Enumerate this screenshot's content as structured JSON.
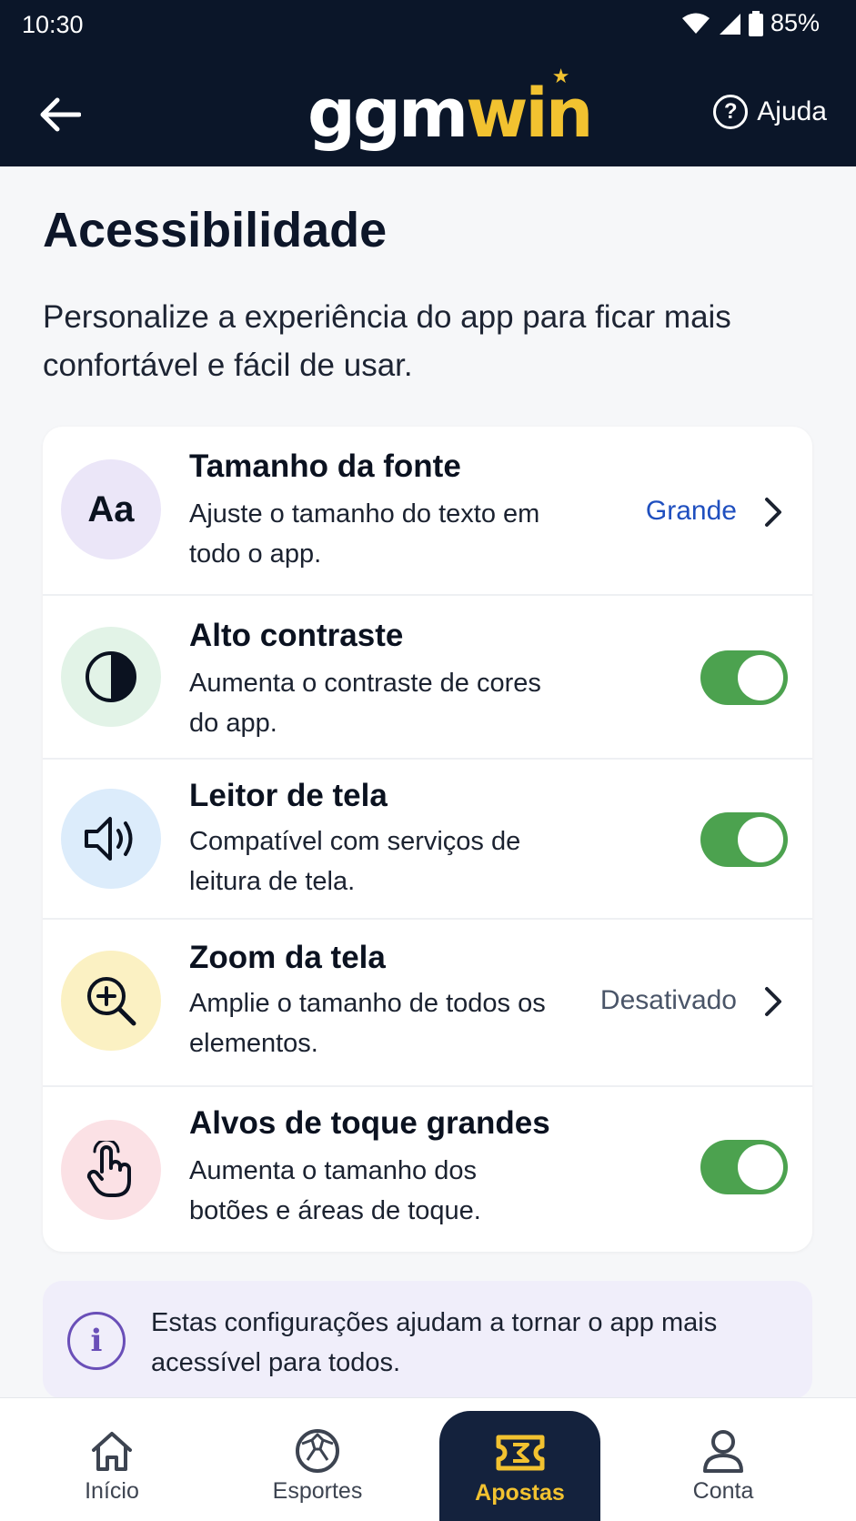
{
  "status_bar": {
    "time": "10:30",
    "battery": "85%"
  },
  "header": {
    "logo_gg": "ggm",
    "logo_win": "win",
    "help_label": "Ajuda"
  },
  "page": {
    "title": "Acessibilidade",
    "subtitle": "Personalize a experiência do app para ficar mais confortável e fácil de usar."
  },
  "settings": [
    {
      "title": "Tamanho da fonte",
      "description": "Ajuste o tamanho do texto em todo o app.",
      "value": "Grande",
      "icon": "font-size-icon",
      "icon_text": "Aa"
    },
    {
      "title": "Alto contraste",
      "description": "Aumenta o contraste de cores do app.",
      "toggle": true,
      "icon": "contrast-icon"
    },
    {
      "title": "Leitor de tela",
      "description": "Compatível com serviços de leitura de tela.",
      "toggle": true,
      "icon": "speaker-icon"
    },
    {
      "title": "Zoom da tela",
      "description": "Amplie o tamanho de todos os elementos.",
      "value": "Desativado",
      "icon": "zoom-in-icon"
    },
    {
      "title": "Alvos de toque grandes",
      "description": "Aumenta o tamanho dos botões e áreas de toque.",
      "toggle": true,
      "icon": "touch-hand-icon"
    }
  ],
  "info": {
    "text": "Estas configurações ajudam a tornar o app mais acessível para todos.",
    "icon_text": "i"
  },
  "bottom_nav": [
    {
      "label": "Início",
      "icon": "home-icon"
    },
    {
      "label": "Esportes",
      "icon": "sports-icon"
    },
    {
      "label": "Apostas",
      "icon": "ticket-icon",
      "active": true
    },
    {
      "label": "Conta",
      "icon": "user-icon"
    }
  ],
  "colors": {
    "header_bg": "#0b1629",
    "brand_yellow": "#f2c230",
    "toggle_on": "#4ca24f",
    "value_blue": "#1f4fbf",
    "value_gray": "#4a5568"
  }
}
